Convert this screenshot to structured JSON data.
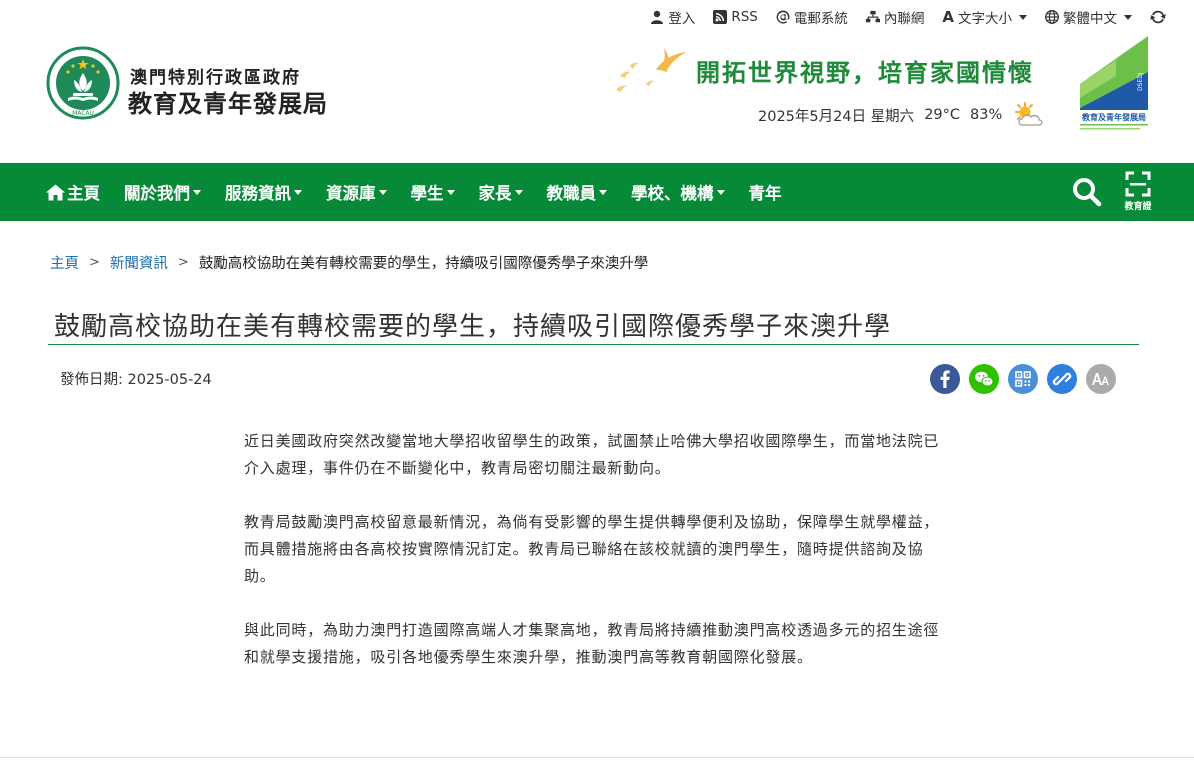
{
  "topbar": {
    "login": "登入",
    "rss": "RSS",
    "email": "電郵系統",
    "intranet": "內聯網",
    "font_size": "文字大小",
    "language": "繁體中文"
  },
  "header": {
    "org_line1": "澳門特別行政區政府",
    "org_line2": "教育及青年發展局",
    "slogan": "開拓世界視野，培育家國情懷",
    "date": "2025年5月24日 星期六",
    "temperature": "29°C",
    "humidity": "83%",
    "emblem_label": "MACAU",
    "dsedj_label": "教育及青年發展局",
    "dsedj_side": "DSEDJ"
  },
  "nav": {
    "items": [
      {
        "label": "主頁",
        "dropdown": false
      },
      {
        "label": "關於我們",
        "dropdown": true
      },
      {
        "label": "服務資訊",
        "dropdown": true
      },
      {
        "label": "資源庫",
        "dropdown": true
      },
      {
        "label": "學生",
        "dropdown": true
      },
      {
        "label": "家長",
        "dropdown": true
      },
      {
        "label": "教職員",
        "dropdown": true
      },
      {
        "label": "學校、機構",
        "dropdown": true
      },
      {
        "label": "青年",
        "dropdown": false
      }
    ],
    "eduid_label": "教育證"
  },
  "breadcrumb": {
    "home": "主頁",
    "news": "新聞資訊",
    "current": "鼓勵高校協助在美有轉校需要的學生，持續吸引國際優秀學子來澳升學"
  },
  "article": {
    "title": "鼓勵高校協助在美有轉校需要的學生，持續吸引國際優秀學子來澳升學",
    "pubdate_label": "發佈日期: 2025-05-24",
    "paragraphs": [
      "近日美國政府突然改變當地大學招收留學生的政策，試圖禁止哈佛大學招收國際學生，而當地法院已介入處理，事件仍在不斷變化中，教青局密切關注最新動向。",
      "教青局鼓勵澳門高校留意最新情況，為倘有受影響的學生提供轉學便利及協助，保障學生就學權益，而具體措施將由各高校按實際情況訂定。教青局已聯絡在該校就讀的澳門學生，隨時提供諮詢及協助。",
      "與此同時，為助力澳門打造國際高端人才集聚高地，教青局將持續推動澳門高校透過多元的招生途徑和就學支援措施，吸引各地優秀學生來澳升學，推動澳門高等教育朝國際化發展。"
    ]
  },
  "share": [
    {
      "icon": "facebook-icon",
      "color": "#3b5998"
    },
    {
      "icon": "wechat-icon",
      "color": "#2dc100"
    },
    {
      "icon": "qrcode-icon",
      "color": "#4a90d9"
    },
    {
      "icon": "link-icon",
      "color": "#2f7fe0"
    },
    {
      "icon": "font-size-icon",
      "color": "#aaaaaa"
    }
  ],
  "colors": {
    "nav_green": "#078a37",
    "link_blue": "#1a6fb0",
    "slogan_green": "#1f8a3a"
  }
}
